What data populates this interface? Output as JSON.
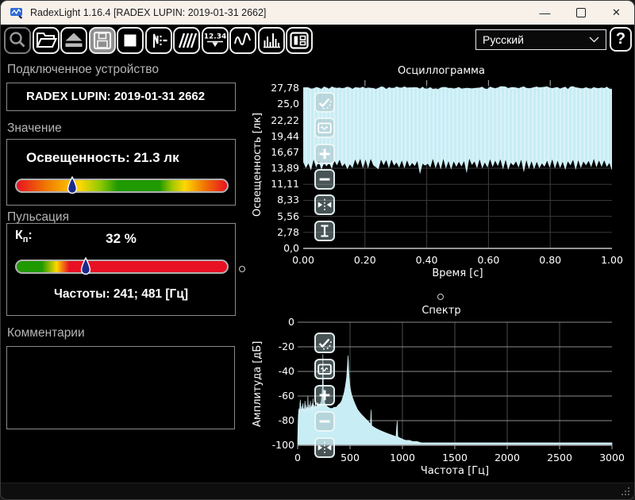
{
  "window": {
    "title": "RadexLight 1.16.4 [RADEX LUPIN: 2019-01-31 2662]"
  },
  "toolbar": {
    "buttons": [
      {
        "name": "magnifier",
        "state": "disabled"
      },
      {
        "name": "open-folder",
        "state": "normal"
      },
      {
        "name": "eject",
        "state": "normal"
      },
      {
        "name": "save",
        "state": "active"
      },
      {
        "name": "stop",
        "state": "normal"
      },
      {
        "name": "wave-dashed",
        "state": "normal"
      },
      {
        "name": "hatch-lines",
        "state": "normal"
      },
      {
        "name": "numeric-display",
        "state": "normal",
        "label": "12.34"
      },
      {
        "name": "waveform",
        "state": "normal"
      },
      {
        "name": "histogram",
        "state": "normal"
      },
      {
        "name": "layout-panels",
        "state": "normal"
      }
    ],
    "language_select": {
      "value": "Русский"
    },
    "help_label": "?"
  },
  "device_panel": {
    "heading": "Подключенное устройство",
    "device": "RADEX LUPIN: 2019-01-31 2662"
  },
  "value_panel": {
    "heading": "Значение",
    "reading": "Освещенность: 21.3 лк",
    "marker_pct": 26.4
  },
  "pulsation_panel": {
    "heading": "Пульсация",
    "kp_main": "К",
    "kp_sub": "п",
    "kp_colon": ":",
    "kp_value": "32 %",
    "marker_pct": 32.7,
    "frequencies": "Частоты: 241; 481 [Гц]"
  },
  "comments_panel": {
    "heading": "Комментарии",
    "text": ""
  },
  "colors": {
    "waveform_fill": "#c8edf4",
    "waveform_fill_light": "#daf4f9",
    "marker_drop": "#1b2a8a",
    "scale_green": "#1f9a00",
    "scale_yellow": "#ffd800",
    "scale_red": "#e81123",
    "titlebar_bg": "#f7f1ea"
  },
  "chart_data": [
    {
      "type": "oscillogram_band",
      "title": "Осциллограмма",
      "xlabel": "Время [с]",
      "ylabel": "Освещенность [лк]",
      "xlim": [
        0,
        1
      ],
      "ylim": [
        0,
        29.17
      ],
      "x_tick_values": [
        0,
        0.2,
        0.4,
        0.6,
        0.8,
        1.0
      ],
      "x_tick_labels": [
        "0.00",
        "0.20",
        "0.40",
        "0.60",
        "0.80",
        "1.00"
      ],
      "y_tick_values": [
        27.78,
        25.0,
        22.22,
        19.44,
        16.67,
        13.89,
        11.11,
        8.33,
        5.56,
        2.78,
        0
      ],
      "y_tick_labels": [
        "27,78",
        "25,0",
        "22,22",
        "19,44",
        "16,67",
        "13,89",
        "11,11",
        "8,33",
        "5,56",
        "2,78",
        "0,0"
      ],
      "band": {
        "top_mean": 27.85,
        "top_jitter": 0.5,
        "bottom_mean": 14.55,
        "tooth": 0.55,
        "bottom_jitter": 0.9,
        "samples": 120
      },
      "mean_value_lux": 21.3,
      "tools": [
        "autoscale",
        "fit-window",
        "zoom-in",
        "zoom-out",
        "expand-horizontal",
        "cursor-vertical"
      ]
    },
    {
      "type": "area",
      "title": "Спектр",
      "xlabel": "Частота [Гц]",
      "ylabel": "Амплитуда [дБ]",
      "xlim": [
        0,
        3000
      ],
      "ylim": [
        -100,
        0
      ],
      "x_tick_values": [
        0,
        500,
        1000,
        1500,
        2000,
        2500,
        3000
      ],
      "x_tick_labels": [
        "0",
        "500",
        "1000",
        "1500",
        "2000",
        "2500",
        "3000"
      ],
      "y_tick_values": [
        0,
        -20,
        -40,
        -60,
        -80,
        -100
      ],
      "y_tick_labels": [
        "0",
        "-20",
        "-40",
        "-60",
        "-80",
        "-100"
      ],
      "peaks_hz": [
        241,
        481
      ],
      "points": [
        [
          0,
          -96
        ],
        [
          3,
          -84
        ],
        [
          6,
          -76
        ],
        [
          10,
          -72
        ],
        [
          14,
          -70
        ],
        [
          18,
          -74
        ],
        [
          22,
          -66
        ],
        [
          26,
          -63
        ],
        [
          30,
          -71
        ],
        [
          34,
          -73
        ],
        [
          38,
          -68
        ],
        [
          42,
          -74
        ],
        [
          46,
          -69
        ],
        [
          50,
          -66
        ],
        [
          54,
          -72
        ],
        [
          58,
          -70
        ],
        [
          62,
          -74
        ],
        [
          66,
          -68
        ],
        [
          70,
          -64
        ],
        [
          74,
          -71
        ],
        [
          78,
          -73
        ],
        [
          82,
          -67
        ],
        [
          86,
          -72
        ],
        [
          90,
          -69
        ],
        [
          94,
          -73
        ],
        [
          98,
          -60
        ],
        [
          102,
          -70
        ],
        [
          106,
          -72
        ],
        [
          110,
          -67
        ],
        [
          114,
          -73
        ],
        [
          118,
          -69
        ],
        [
          122,
          -64
        ],
        [
          126,
          -71
        ],
        [
          130,
          -68
        ],
        [
          134,
          -72
        ],
        [
          138,
          -66
        ],
        [
          142,
          -73
        ],
        [
          146,
          -62
        ],
        [
          150,
          -70
        ],
        [
          154,
          -67
        ],
        [
          158,
          -72
        ],
        [
          162,
          -68
        ],
        [
          166,
          -71
        ],
        [
          170,
          -63
        ],
        [
          174,
          -70
        ],
        [
          178,
          -68
        ],
        [
          182,
          -72
        ],
        [
          186,
          -66
        ],
        [
          190,
          -70
        ],
        [
          194,
          -65
        ],
        [
          198,
          -69
        ],
        [
          202,
          -67
        ],
        [
          206,
          -70
        ],
        [
          210,
          -66
        ],
        [
          214,
          -69
        ],
        [
          218,
          -65
        ],
        [
          222,
          -68
        ],
        [
          226,
          -63
        ],
        [
          230,
          -60
        ],
        [
          234,
          -56
        ],
        [
          237,
          -46
        ],
        [
          239,
          -36
        ],
        [
          241,
          -26
        ],
        [
          243,
          -38
        ],
        [
          245,
          -50
        ],
        [
          248,
          -58
        ],
        [
          252,
          -62
        ],
        [
          258,
          -65
        ],
        [
          266,
          -67
        ],
        [
          276,
          -68
        ],
        [
          290,
          -69
        ],
        [
          310,
          -70
        ],
        [
          330,
          -70
        ],
        [
          350,
          -69
        ],
        [
          370,
          -69
        ],
        [
          390,
          -67
        ],
        [
          405,
          -66
        ],
        [
          420,
          -64
        ],
        [
          435,
          -60
        ],
        [
          445,
          -57
        ],
        [
          455,
          -52
        ],
        [
          462,
          -48
        ],
        [
          468,
          -44
        ],
        [
          473,
          -38
        ],
        [
          477,
          -32
        ],
        [
          481,
          -27
        ],
        [
          484,
          -31
        ],
        [
          487,
          -38
        ],
        [
          492,
          -45
        ],
        [
          498,
          -51
        ],
        [
          505,
          -55
        ],
        [
          515,
          -59
        ],
        [
          527,
          -62
        ],
        [
          540,
          -65
        ],
        [
          555,
          -68
        ],
        [
          572,
          -71
        ],
        [
          590,
          -73
        ],
        [
          610,
          -75
        ],
        [
          632,
          -77
        ],
        [
          655,
          -79
        ],
        [
          678,
          -81
        ],
        [
          695,
          -83
        ],
        [
          701,
          -71
        ],
        [
          707,
          -84
        ],
        [
          722,
          -85
        ],
        [
          740,
          -86
        ],
        [
          762,
          -87
        ],
        [
          788,
          -88
        ],
        [
          815,
          -89
        ],
        [
          845,
          -90
        ],
        [
          878,
          -91
        ],
        [
          910,
          -92
        ],
        [
          938,
          -93
        ],
        [
          950,
          -80
        ],
        [
          956,
          -93
        ],
        [
          975,
          -94
        ],
        [
          1000,
          -95
        ],
        [
          1030,
          -96
        ],
        [
          1065,
          -96
        ],
        [
          1100,
          -97
        ],
        [
          1140,
          -97
        ],
        [
          1180,
          -98
        ],
        [
          1250,
          -98
        ],
        [
          1350,
          -98
        ],
        [
          1450,
          -98
        ],
        [
          1550,
          -98
        ],
        [
          1700,
          -98
        ],
        [
          1850,
          -98
        ],
        [
          2000,
          -98
        ],
        [
          2150,
          -98
        ],
        [
          2300,
          -98
        ],
        [
          2450,
          -98
        ],
        [
          2600,
          -98
        ],
        [
          2750,
          -98
        ],
        [
          2900,
          -98
        ],
        [
          3000,
          -98
        ]
      ],
      "tools": [
        "autoscale",
        "fit-window",
        "zoom-in",
        "zoom-out",
        "expand-horizontal"
      ]
    }
  ]
}
